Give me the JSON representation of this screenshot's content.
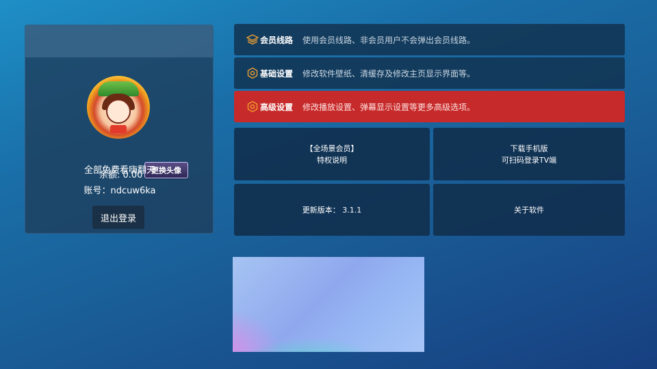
{
  "account": {
    "balance": "余额: 0.00",
    "change_avatar_label": "更换头像",
    "free_text": "全部免费看嗨翻天",
    "account_label": "账号：ndcuw6ka",
    "logout_label": "退出登录"
  },
  "menu": [
    {
      "title": "会员线路",
      "desc": "使用会员线路、非会员用户不会弹出会员线路。",
      "icon": "layers-icon",
      "active": false
    },
    {
      "title": "基础设置",
      "desc": "修改软件壁纸、清缓存及修改主页显示界面等。",
      "icon": "gear-icon",
      "active": false
    },
    {
      "title": "高级设置",
      "desc": "修改播放设置、弹幕显示设置等更多高级选项。",
      "icon": "gear-icon",
      "active": true
    }
  ],
  "tiles": {
    "vip": {
      "line1": "【全场景会员】",
      "line2": "特权说明"
    },
    "download": {
      "line1": "下载手机版",
      "line2": "可扫码登录TV端"
    },
    "version": {
      "label": "更新版本：  3.1.1"
    },
    "about": {
      "label": "关于软件"
    }
  },
  "colors": {
    "active_row": "#c62a2a",
    "icon_orange": "#f0a030",
    "button_purple": "#5a4f86"
  }
}
